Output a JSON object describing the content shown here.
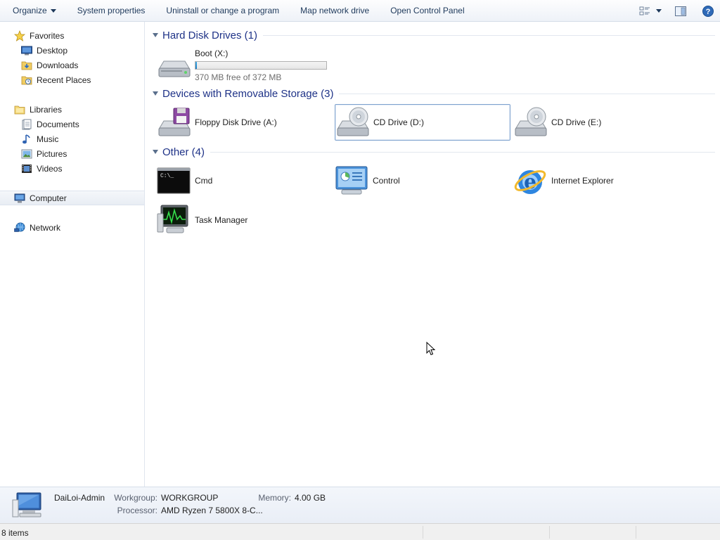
{
  "toolbar": {
    "organize": "Organize",
    "system_properties": "System properties",
    "uninstall": "Uninstall or change a program",
    "map_drive": "Map network drive",
    "open_control_panel": "Open Control Panel"
  },
  "nav": {
    "favorites": "Favorites",
    "desktop": "Desktop",
    "downloads": "Downloads",
    "recent_places": "Recent Places",
    "libraries": "Libraries",
    "documents": "Documents",
    "music": "Music",
    "pictures": "Pictures",
    "videos": "Videos",
    "computer": "Computer",
    "network": "Network"
  },
  "groups": {
    "hdd": "Hard Disk Drives (1)",
    "removable": "Devices with Removable Storage (3)",
    "other": "Other (4)"
  },
  "drives": {
    "boot_name": "Boot (X:)",
    "boot_space": "370 MB free of 372 MB",
    "boot_used_fraction": 0.005,
    "floppy": "Floppy Disk Drive (A:)",
    "cd_d": "CD Drive (D:)",
    "cd_e": "CD Drive (E:)"
  },
  "other": {
    "cmd": "Cmd",
    "control": "Control",
    "ie": "Internet Explorer",
    "task_manager": "Task Manager"
  },
  "details": {
    "name": "DaiLoi-Admin",
    "workgroup_label": "Workgroup:",
    "workgroup": "WORKGROUP",
    "memory_label": "Memory:",
    "memory": "4.00 GB",
    "processor_label": "Processor:",
    "processor": "AMD Ryzen 7 5800X 8-C..."
  },
  "status": {
    "items": "8 items"
  },
  "colors": {
    "group_header": "#1e3287",
    "toolbar_text": "#1e395b",
    "selection_border": "#7da2ce",
    "progress_fill": "#2a8fd6"
  }
}
